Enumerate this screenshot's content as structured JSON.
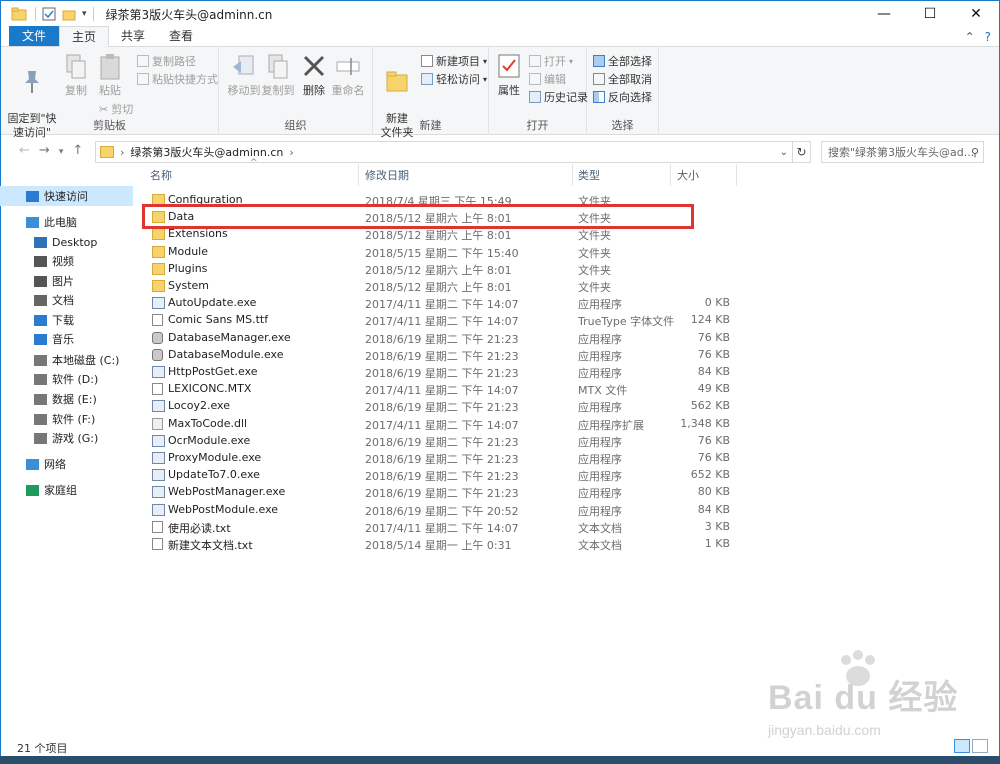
{
  "window": {
    "title": "绿茶第3版火车头@adminn.cn",
    "controls": {
      "minimize": "—",
      "maximize": "☐",
      "close": "✕"
    }
  },
  "ribbon_tabs": [
    {
      "label": "文件"
    },
    {
      "label": "主页"
    },
    {
      "label": "共享"
    },
    {
      "label": "查看"
    }
  ],
  "ribbon": {
    "clipboard": {
      "label": "剪贴板",
      "pin": "固定到\"快\n速访问\"",
      "copy": "复制",
      "paste": "粘贴",
      "copy_path": "复制路径",
      "paste_shortcut": "粘贴快捷方式",
      "cut": "剪切"
    },
    "organize": {
      "label": "组织",
      "move_to": "移动到",
      "copy_to": "复制到",
      "delete": "删除",
      "rename": "重命名"
    },
    "new": {
      "label": "新建",
      "new_folder": "新建\n文件夹",
      "new_item": "新建项目",
      "easy_access": "轻松访问"
    },
    "open": {
      "label": "打开",
      "properties": "属性",
      "open": "打开",
      "edit": "编辑",
      "history": "历史记录"
    },
    "select": {
      "label": "选择",
      "select_all": "全部选择",
      "select_none": "全部取消",
      "invert": "反向选择"
    }
  },
  "address": {
    "path": "绿茶第3版火车头@adminn.cn",
    "search_placeholder": "搜索\"绿茶第3版火车头@ad..."
  },
  "sidebar": [
    {
      "label": "快速访问",
      "icon": "star-icon",
      "selected": true
    },
    {
      "label": "此电脑",
      "icon": "pc-icon"
    },
    {
      "label": "Desktop",
      "icon": "desktop-icon"
    },
    {
      "label": "视频",
      "icon": "video-icon"
    },
    {
      "label": "图片",
      "icon": "pictures-icon"
    },
    {
      "label": "文档",
      "icon": "documents-icon"
    },
    {
      "label": "下载",
      "icon": "download-icon"
    },
    {
      "label": "音乐",
      "icon": "music-icon"
    },
    {
      "label": "本地磁盘 (C:)",
      "icon": "drive-icon"
    },
    {
      "label": "软件 (D:)",
      "icon": "drive-icon"
    },
    {
      "label": "数据 (E:)",
      "icon": "drive-icon"
    },
    {
      "label": "软件 (F:)",
      "icon": "drive-icon"
    },
    {
      "label": "游戏 (G:)",
      "icon": "drive-icon"
    },
    {
      "label": "网络",
      "icon": "network-icon"
    },
    {
      "label": "家庭组",
      "icon": "homegroup-icon"
    }
  ],
  "columns": {
    "name": "名称",
    "date": "修改日期",
    "type": "类型",
    "size": "大小"
  },
  "files": [
    {
      "name": "Configuration",
      "date": "2018/7/4 星期三 下午 15:49",
      "type": "文件夹",
      "size": "",
      "kind": "folder"
    },
    {
      "name": "Data",
      "date": "2018/5/12 星期六 上午 8:01",
      "type": "文件夹",
      "size": "",
      "kind": "folder"
    },
    {
      "name": "Extensions",
      "date": "2018/5/12 星期六 上午 8:01",
      "type": "文件夹",
      "size": "",
      "kind": "folder"
    },
    {
      "name": "Module",
      "date": "2018/5/15 星期二 下午 15:40",
      "type": "文件夹",
      "size": "",
      "kind": "folder"
    },
    {
      "name": "Plugins",
      "date": "2018/5/12 星期六 上午 8:01",
      "type": "文件夹",
      "size": "",
      "kind": "folder"
    },
    {
      "name": "System",
      "date": "2018/5/12 星期六 上午 8:01",
      "type": "文件夹",
      "size": "",
      "kind": "folder"
    },
    {
      "name": "AutoUpdate.exe",
      "date": "2017/4/11 星期二 下午 14:07",
      "type": "应用程序",
      "size": "0 KB",
      "kind": "exe"
    },
    {
      "name": "Comic Sans MS.ttf",
      "date": "2017/4/11 星期二 下午 14:07",
      "type": "TrueType 字体文件",
      "size": "124 KB",
      "kind": "file"
    },
    {
      "name": "DatabaseManager.exe",
      "date": "2018/6/19 星期二 下午 21:23",
      "type": "应用程序",
      "size": "76 KB",
      "kind": "db"
    },
    {
      "name": "DatabaseModule.exe",
      "date": "2018/6/19 星期二 下午 21:23",
      "type": "应用程序",
      "size": "76 KB",
      "kind": "db"
    },
    {
      "name": "HttpPostGet.exe",
      "date": "2018/6/19 星期二 下午 21:23",
      "type": "应用程序",
      "size": "84 KB",
      "kind": "exe"
    },
    {
      "name": "LEXICONC.MTX",
      "date": "2017/4/11 星期二 下午 14:07",
      "type": "MTX 文件",
      "size": "49 KB",
      "kind": "file"
    },
    {
      "name": "Locoy2.exe",
      "date": "2018/6/19 星期二 下午 21:23",
      "type": "应用程序",
      "size": "562 KB",
      "kind": "exe"
    },
    {
      "name": "MaxToCode.dll",
      "date": "2017/4/11 星期二 下午 14:07",
      "type": "应用程序扩展",
      "size": "1,348 KB",
      "kind": "dll"
    },
    {
      "name": "OcrModule.exe",
      "date": "2018/6/19 星期二 下午 21:23",
      "type": "应用程序",
      "size": "76 KB",
      "kind": "exe"
    },
    {
      "name": "ProxyModule.exe",
      "date": "2018/6/19 星期二 下午 21:23",
      "type": "应用程序",
      "size": "76 KB",
      "kind": "exe"
    },
    {
      "name": "UpdateTo7.0.exe",
      "date": "2018/6/19 星期二 下午 21:23",
      "type": "应用程序",
      "size": "652 KB",
      "kind": "exe"
    },
    {
      "name": "WebPostManager.exe",
      "date": "2018/6/19 星期二 下午 21:23",
      "type": "应用程序",
      "size": "80 KB",
      "kind": "exe"
    },
    {
      "name": "WebPostModule.exe",
      "date": "2018/6/19 星期二 下午 20:52",
      "type": "应用程序",
      "size": "84 KB",
      "kind": "exe"
    },
    {
      "name": "使用必读.txt",
      "date": "2017/4/11 星期二 下午 14:07",
      "type": "文本文档",
      "size": "3 KB",
      "kind": "file"
    },
    {
      "name": "新建文本文档.txt",
      "date": "2018/5/14 星期一 上午 0:31",
      "type": "文本文档",
      "size": "1 KB",
      "kind": "file"
    }
  ],
  "status": {
    "count": "21 个项目"
  },
  "watermark": {
    "brand": "Bai du 经验",
    "url": "jingyan.baidu.com"
  },
  "colors": {
    "accent": "#1979ca",
    "highlight_box": "#e0342f",
    "selection": "#cce8ff",
    "folder": "#f7d36b"
  }
}
